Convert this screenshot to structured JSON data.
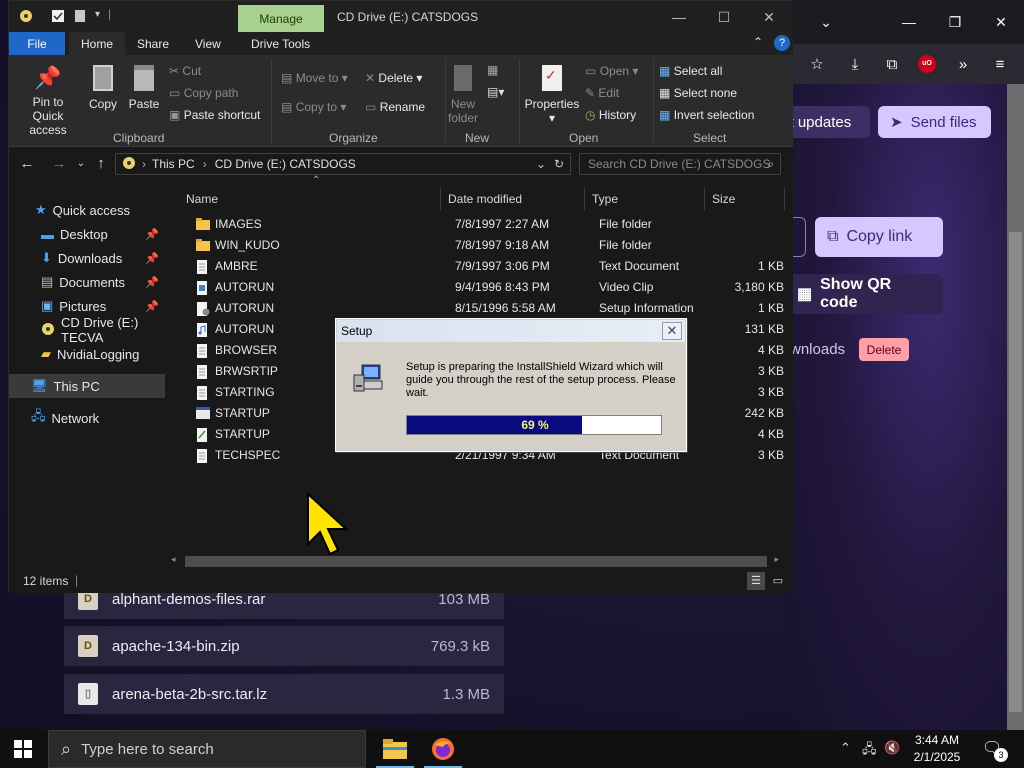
{
  "explorer": {
    "title": "CD Drive (E:) CATSDOGS",
    "manage_tab": "Manage",
    "tabs": [
      "File",
      "Home",
      "Share",
      "View",
      "Drive Tools"
    ],
    "ribbon": {
      "pin_line1": "Pin to Quick",
      "pin_line2": "access",
      "copy": "Copy",
      "paste": "Paste",
      "cut": "Cut",
      "copy_path": "Copy path",
      "paste_shortcut": "Paste shortcut",
      "move_to": "Move to",
      "copy_to": "Copy to",
      "delete": "Delete",
      "rename": "Rename",
      "new_folder_line1": "New",
      "new_folder_line2": "folder",
      "properties": "Properties",
      "open": "Open",
      "edit": "Edit",
      "history": "History",
      "select_all": "Select all",
      "select_none": "Select none",
      "invert_selection": "Invert selection",
      "groups": [
        "Clipboard",
        "Organize",
        "New",
        "Open",
        "Select"
      ]
    },
    "address": {
      "crumb1": "This PC",
      "crumb2": "CD Drive (E:) CATSDOGS"
    },
    "search_placeholder": "Search CD Drive (E:) CATSDOGS",
    "nav": [
      {
        "label": "Quick access"
      },
      {
        "label": "Desktop"
      },
      {
        "label": "Downloads"
      },
      {
        "label": "Documents"
      },
      {
        "label": "Pictures"
      },
      {
        "label": "CD Drive (E:) TECVA"
      },
      {
        "label": "NvidiaLogging"
      },
      {
        "label": "This PC"
      },
      {
        "label": "Network"
      }
    ],
    "columns": [
      "Name",
      "Date modified",
      "Type",
      "Size"
    ],
    "files": [
      {
        "name": "IMAGES",
        "date": "7/8/1997 2:27 AM",
        "type": "File folder",
        "size": "",
        "icon": "folder"
      },
      {
        "name": "WIN_KUDO",
        "date": "7/8/1997 9:18 AM",
        "type": "File folder",
        "size": "",
        "icon": "folder"
      },
      {
        "name": "AMBRE",
        "date": "7/9/1997 3:06 PM",
        "type": "Text Document",
        "size": "1 KB",
        "icon": "doc"
      },
      {
        "name": "AUTORUN",
        "date": "9/4/1996 8:43 PM",
        "type": "Video Clip",
        "size": "3,180 KB",
        "icon": "video"
      },
      {
        "name": "AUTORUN",
        "date": "8/15/1996 5:58 AM",
        "type": "Setup Information",
        "size": "1 KB",
        "icon": "setup"
      },
      {
        "name": "AUTORUN",
        "date": "",
        "type": "",
        "size": "131 KB",
        "icon": "music"
      },
      {
        "name": "BROWSER",
        "date": "",
        "type": "",
        "size": "4 KB",
        "icon": "doc"
      },
      {
        "name": "BRWSRTIP",
        "date": "",
        "type": "",
        "size": "3 KB",
        "icon": "doc"
      },
      {
        "name": "STARTING",
        "date": "",
        "type": "",
        "size": "3 KB",
        "icon": "doc"
      },
      {
        "name": "STARTUP",
        "date": "",
        "type": "",
        "size": "242 KB",
        "icon": "exe"
      },
      {
        "name": "STARTUP",
        "date": "",
        "type": "",
        "size": "4 KB",
        "icon": "ini"
      },
      {
        "name": "TECHSPEC",
        "date": "2/21/1997 9:34 AM",
        "type": "Text Document",
        "size": "3 KB",
        "icon": "doc"
      }
    ],
    "status": "12 items"
  },
  "dialog": {
    "title": "Setup",
    "message": "Setup is preparing the InstallShield Wizard which will guide you through the rest of the setup process.  Please wait.",
    "progress_percent": 69,
    "progress_label": "69 %"
  },
  "browser": {
    "updates_label": "ct updates",
    "send_files": "Send files",
    "copy_link": "Copy link",
    "show_qr": "Show QR code",
    "downloads_label": "wnloads",
    "delete_label": "Delete",
    "files": [
      {
        "name": "alphant-demos-files.rar",
        "size": "103 MB"
      },
      {
        "name": "apache-134-bin.zip",
        "size": "769.3 kB"
      },
      {
        "name": "arena-beta-2b-src.tar.lz",
        "size": "1.3 MB"
      }
    ]
  },
  "taskbar": {
    "search_placeholder": "Type here to search",
    "time": "3:44 AM",
    "date": "2/1/2025",
    "notification_count": "3"
  },
  "colors": {
    "accent_blue": "#1f68c7",
    "manage_green": "#a9d18e",
    "progress_navy": "#0a0a80",
    "send_purple": "#d7c7ff"
  }
}
